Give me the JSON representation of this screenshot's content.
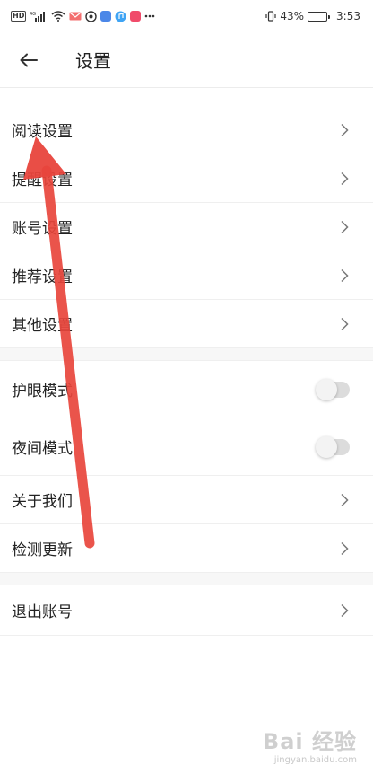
{
  "status_bar": {
    "hd": "HD",
    "signal_type": "4G",
    "battery_percent": "43%",
    "battery_level": 0.43,
    "time": "3:53",
    "icons": [
      "hd-badge",
      "signal-icon",
      "wifi-icon",
      "mail-icon",
      "app-icon",
      "app-icon",
      "music-icon",
      "app-icon",
      "more-dots-icon",
      "vibrate-icon",
      "battery-icon"
    ]
  },
  "header": {
    "back_icon": "arrow-left-icon",
    "title": "设置"
  },
  "settings": {
    "group1": [
      {
        "label": "阅读设置"
      },
      {
        "label": "提醒设置"
      },
      {
        "label": "账号设置"
      },
      {
        "label": "推荐设置"
      },
      {
        "label": "其他设置"
      }
    ],
    "toggles": [
      {
        "label": "护眼模式",
        "on": false
      },
      {
        "label": "夜间模式",
        "on": false
      }
    ],
    "group3": [
      {
        "label": "关于我们"
      },
      {
        "label": "检测更新"
      }
    ],
    "logout": {
      "label": "退出账号"
    }
  },
  "colors": {
    "annotation_arrow": "#e8453c",
    "toggle_off_track": "#dcdcdc",
    "divider": "#efefef"
  },
  "watermark": {
    "brand": "Bai 经验",
    "url": "jingyan.baidu.com"
  }
}
